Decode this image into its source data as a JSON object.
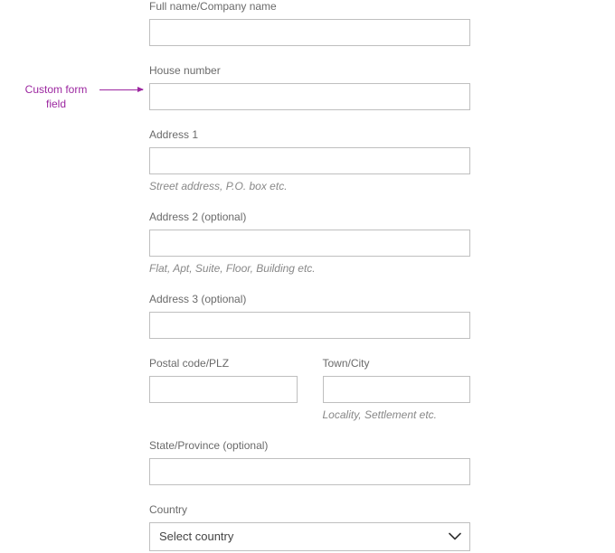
{
  "annotation": {
    "text": "Custom form field"
  },
  "form": {
    "full_name": {
      "label": "Full name/Company name",
      "value": ""
    },
    "house_number": {
      "label": "House number",
      "value": ""
    },
    "address1": {
      "label": "Address 1",
      "value": "",
      "helper": "Street address, P.O. box etc."
    },
    "address2": {
      "label": "Address 2 (optional)",
      "value": "",
      "helper": "Flat, Apt, Suite, Floor, Building etc."
    },
    "address3": {
      "label": "Address 3 (optional)",
      "value": ""
    },
    "postal_code": {
      "label": "Postal code/PLZ",
      "value": ""
    },
    "town_city": {
      "label": "Town/City",
      "value": "",
      "helper": "Locality, Settlement etc."
    },
    "state": {
      "label": "State/Province (optional)",
      "value": ""
    },
    "country": {
      "label": "Country",
      "selected": "Select country"
    }
  }
}
